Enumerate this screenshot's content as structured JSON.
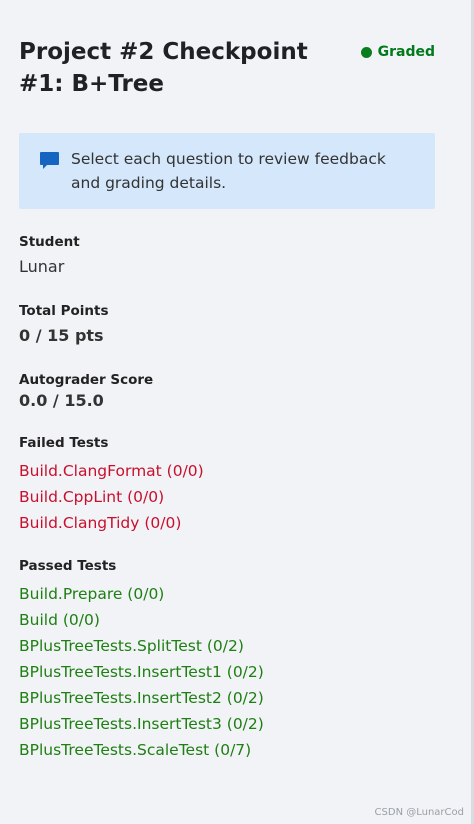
{
  "header": {
    "title": "Project #2 Checkpoint #1: B+Tree",
    "status": "Graded",
    "status_color": "#0a7d1e"
  },
  "notice": {
    "icon": "comment-icon",
    "text": "Select each question to review feedback and grading details."
  },
  "student": {
    "label": "Student",
    "value": "Lunar"
  },
  "total_points": {
    "label": "Total Points",
    "value": "0 / 15 pts"
  },
  "autograder": {
    "label": "Autograder Score",
    "value": "0.0 / 15.0"
  },
  "failed_tests": {
    "label": "Failed Tests",
    "items": [
      "Build.ClangFormat (0/0)",
      "Build.CppLint (0/0)",
      "Build.ClangTidy (0/0)"
    ]
  },
  "passed_tests": {
    "label": "Passed Tests",
    "items": [
      "Build.Prepare (0/0)",
      "Build (0/0)",
      "BPlusTreeTests.SplitTest (0/2)",
      "BPlusTreeTests.InsertTest1 (0/2)",
      "BPlusTreeTests.InsertTest2 (0/2)",
      "BPlusTreeTests.InsertTest3 (0/2)",
      "BPlusTreeTests.ScaleTest (0/7)"
    ]
  },
  "watermark": "CSDN @LunarCod"
}
